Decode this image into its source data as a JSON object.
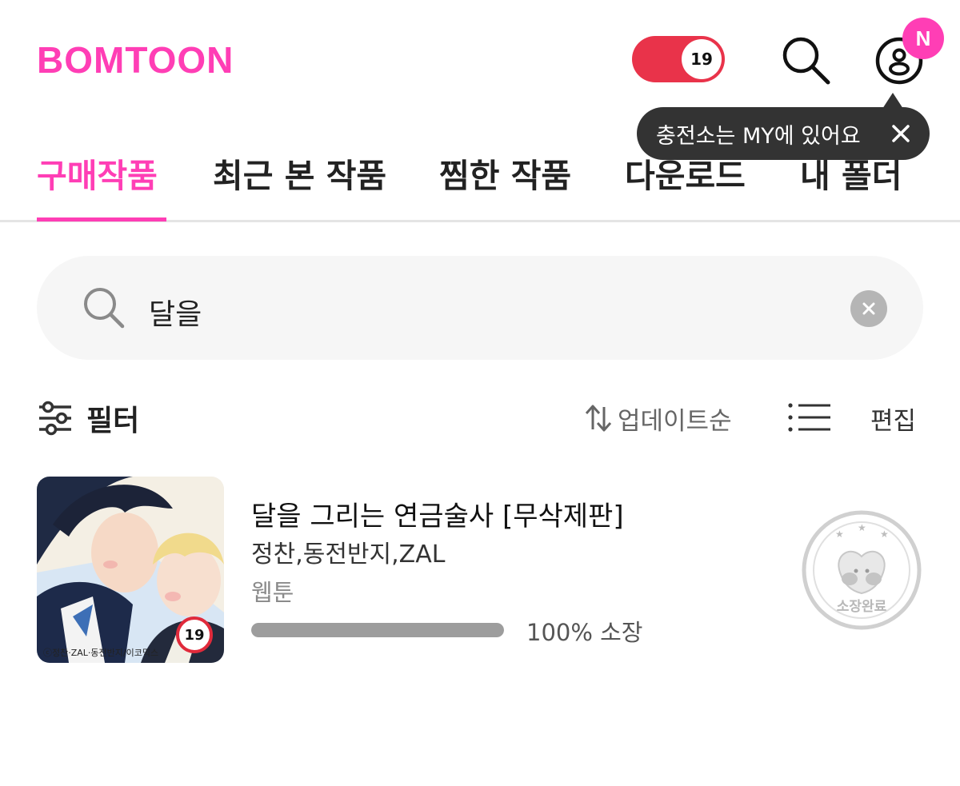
{
  "header": {
    "logo": "BOMTOON",
    "adult_toggle_label": "19",
    "new_badge": "N",
    "brand_color": "#ff3eb5",
    "toggle_color": "#e9334a"
  },
  "tabs": [
    {
      "label": "구매작품",
      "active": true
    },
    {
      "label": "최근 본 작품",
      "active": false
    },
    {
      "label": "찜한 작품",
      "active": false
    },
    {
      "label": "다운로드",
      "active": false
    },
    {
      "label": "내 폴더",
      "active": false
    }
  ],
  "tooltip": {
    "text": "충전소는 MY에 있어요",
    "close_icon": "close-icon"
  },
  "search": {
    "value": "달을",
    "icon": "search-icon",
    "clear_icon": "clear-icon"
  },
  "toolbar": {
    "filter_label": "필터",
    "sort_label": "업데이트순",
    "view_icon": "list-view-icon",
    "edit_label": "편집"
  },
  "items": [
    {
      "title": "달을 그리는 연금술사 [무삭제판]",
      "authors": "정찬,동전반지,ZAL",
      "category": "웹툰",
      "rating": "19",
      "cover_credit": "ⓒ정찬·ZAL·동전반지/이코믹스",
      "progress": 100,
      "progress_text": "100% 소장",
      "stamp_text": "소장완료"
    }
  ]
}
